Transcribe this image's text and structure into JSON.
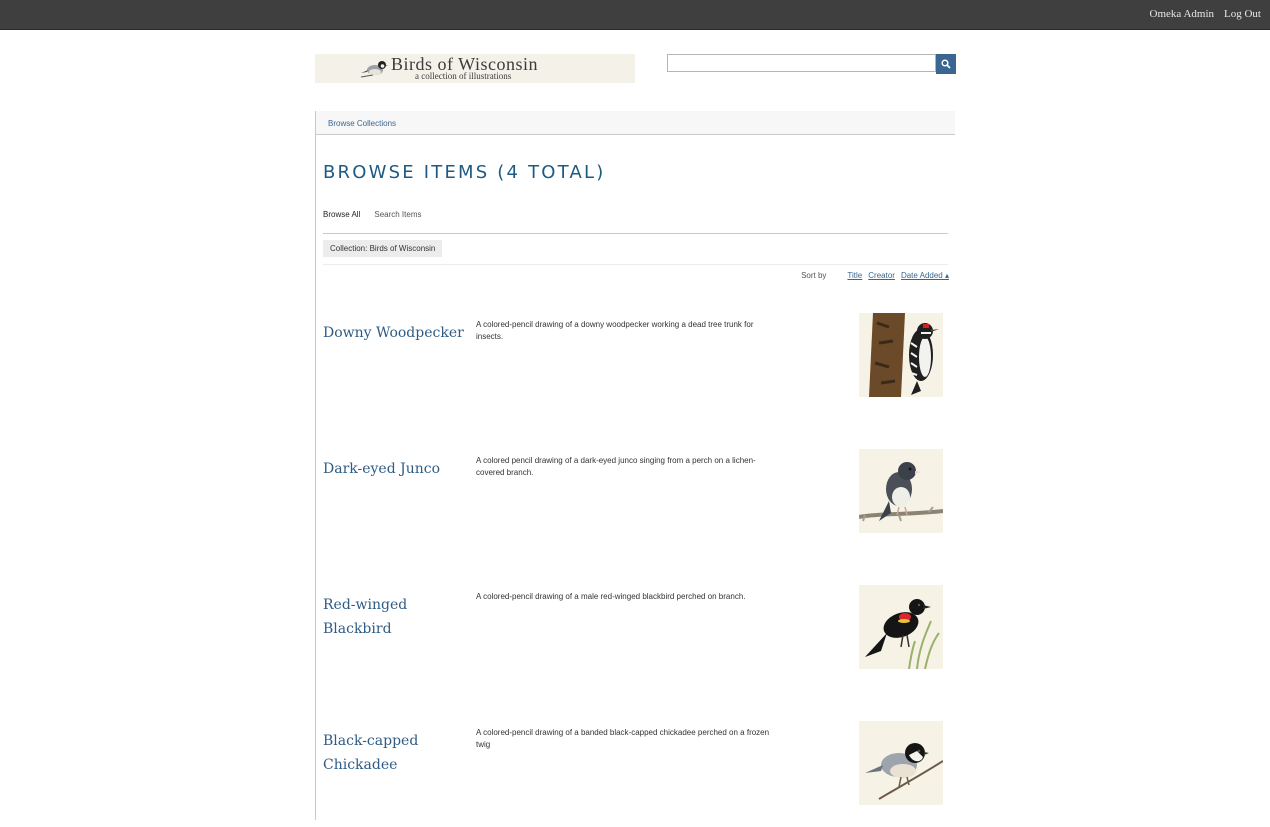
{
  "admin_bar": {
    "user_label": "Omeka Admin",
    "logout_label": "Log Out"
  },
  "header": {
    "site_title": "Birds of Wisconsin",
    "site_subtitle": "a collection of illustrations",
    "search": {
      "value": "",
      "placeholder": ""
    }
  },
  "primary_nav": {
    "browse_collections": "Browse Collections"
  },
  "page": {
    "heading": "BROWSE ITEMS (4 TOTAL)",
    "secondary_nav": {
      "browse_all": "Browse All",
      "search_items": "Search Items"
    },
    "filter_tag": "Collection: Birds of Wisconsin",
    "sort": {
      "label": "Sort by",
      "links": [
        "Title",
        "Creator",
        "Date Added ▴"
      ]
    }
  },
  "items": [
    {
      "title": "Downy Woodpecker",
      "description": "A colored-pencil drawing of a downy woodpecker working a dead tree trunk for insects.",
      "thumbnail_icon": "downy-woodpecker-illustration"
    },
    {
      "title": "Dark-eyed Junco",
      "description": "A colored pencil drawing of a dark-eyed junco singing from a perch on a lichen-covered branch.",
      "thumbnail_icon": "dark-eyed-junco-illustration"
    },
    {
      "title": "Red-winged Blackbird",
      "description": "A colored-pencil drawing of a male red-winged blackbird perched on branch.",
      "thumbnail_icon": "red-winged-blackbird-illustration"
    },
    {
      "title": "Black-capped Chickadee",
      "description": "A colored-pencil drawing of a banded black-capped chickadee perched on a frozen twig",
      "thumbnail_icon": "black-capped-chickadee-illustration"
    }
  ],
  "colors": {
    "admin_bar": "#3f3f3f",
    "link_blue": "#3a6691",
    "heading_blue": "#1e5a82"
  }
}
